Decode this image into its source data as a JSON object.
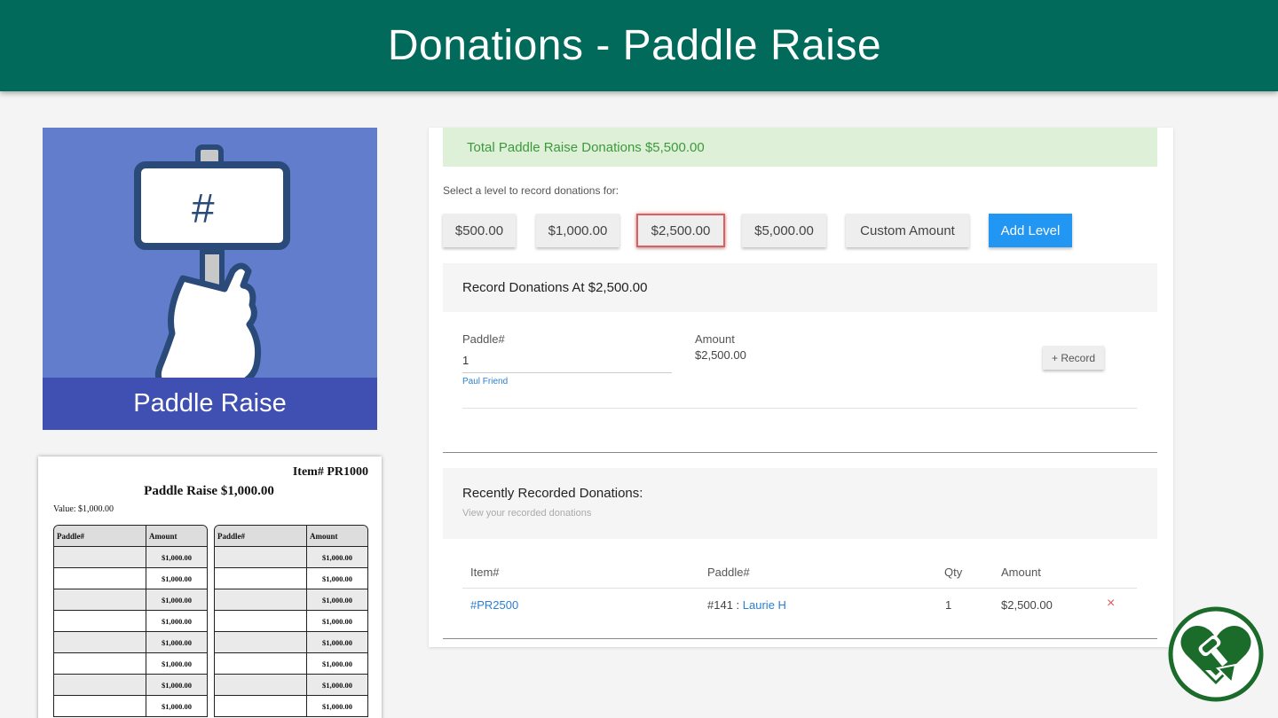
{
  "header": {
    "title": "Donations - Paddle Raise"
  },
  "tile": {
    "label": "Paddle Raise",
    "sign_symbol": "#"
  },
  "paper": {
    "item_number": "Item# PR1000",
    "title": "Paddle Raise $1,000.00",
    "value": "Value: $1,000.00",
    "col_paddle": "Paddle#",
    "col_amount": "Amount",
    "row_amounts": [
      "$1,000.00",
      "$1,000.00",
      "$1,000.00",
      "$1,000.00",
      "$1,000.00",
      "$1,000.00",
      "$1,000.00",
      "$1,000.00"
    ]
  },
  "total": {
    "text": "Total Paddle Raise Donations $5,500.00"
  },
  "levels": {
    "prompt": "Select a level to record donations for:",
    "items": [
      "$500.00",
      "$1,000.00",
      "$2,500.00",
      "$5,000.00",
      "Custom Amount"
    ],
    "selected": "$2,500.00",
    "add_label": "Add Level"
  },
  "record": {
    "title": "Record Donations At $2,500.00",
    "paddle_label": "Paddle#",
    "paddle_value": "1",
    "bidder_name": "Paul Friend",
    "amount_label": "Amount",
    "amount_value": "$2,500.00",
    "record_button": "+ Record"
  },
  "recent": {
    "title": "Recently Recorded Donations:",
    "subtitle": "View your recorded donations",
    "columns": {
      "item": "Item#",
      "paddle": "Paddle#",
      "qty": "Qty",
      "amount": "Amount"
    },
    "rows": [
      {
        "item": "#PR2500",
        "paddle_no": "#141 :",
        "bidder": "Laurie H",
        "qty": "1",
        "amount": "$2,500.00",
        "delete": "×"
      }
    ]
  },
  "colors": {
    "header": "#016a5b",
    "accent": "#2196f3",
    "success_bg": "#dff0d8",
    "success_text": "#3c9a3c",
    "tile": "#627dcc",
    "tile_band": "#3f4fb2",
    "logo": "#1b6b2a"
  }
}
